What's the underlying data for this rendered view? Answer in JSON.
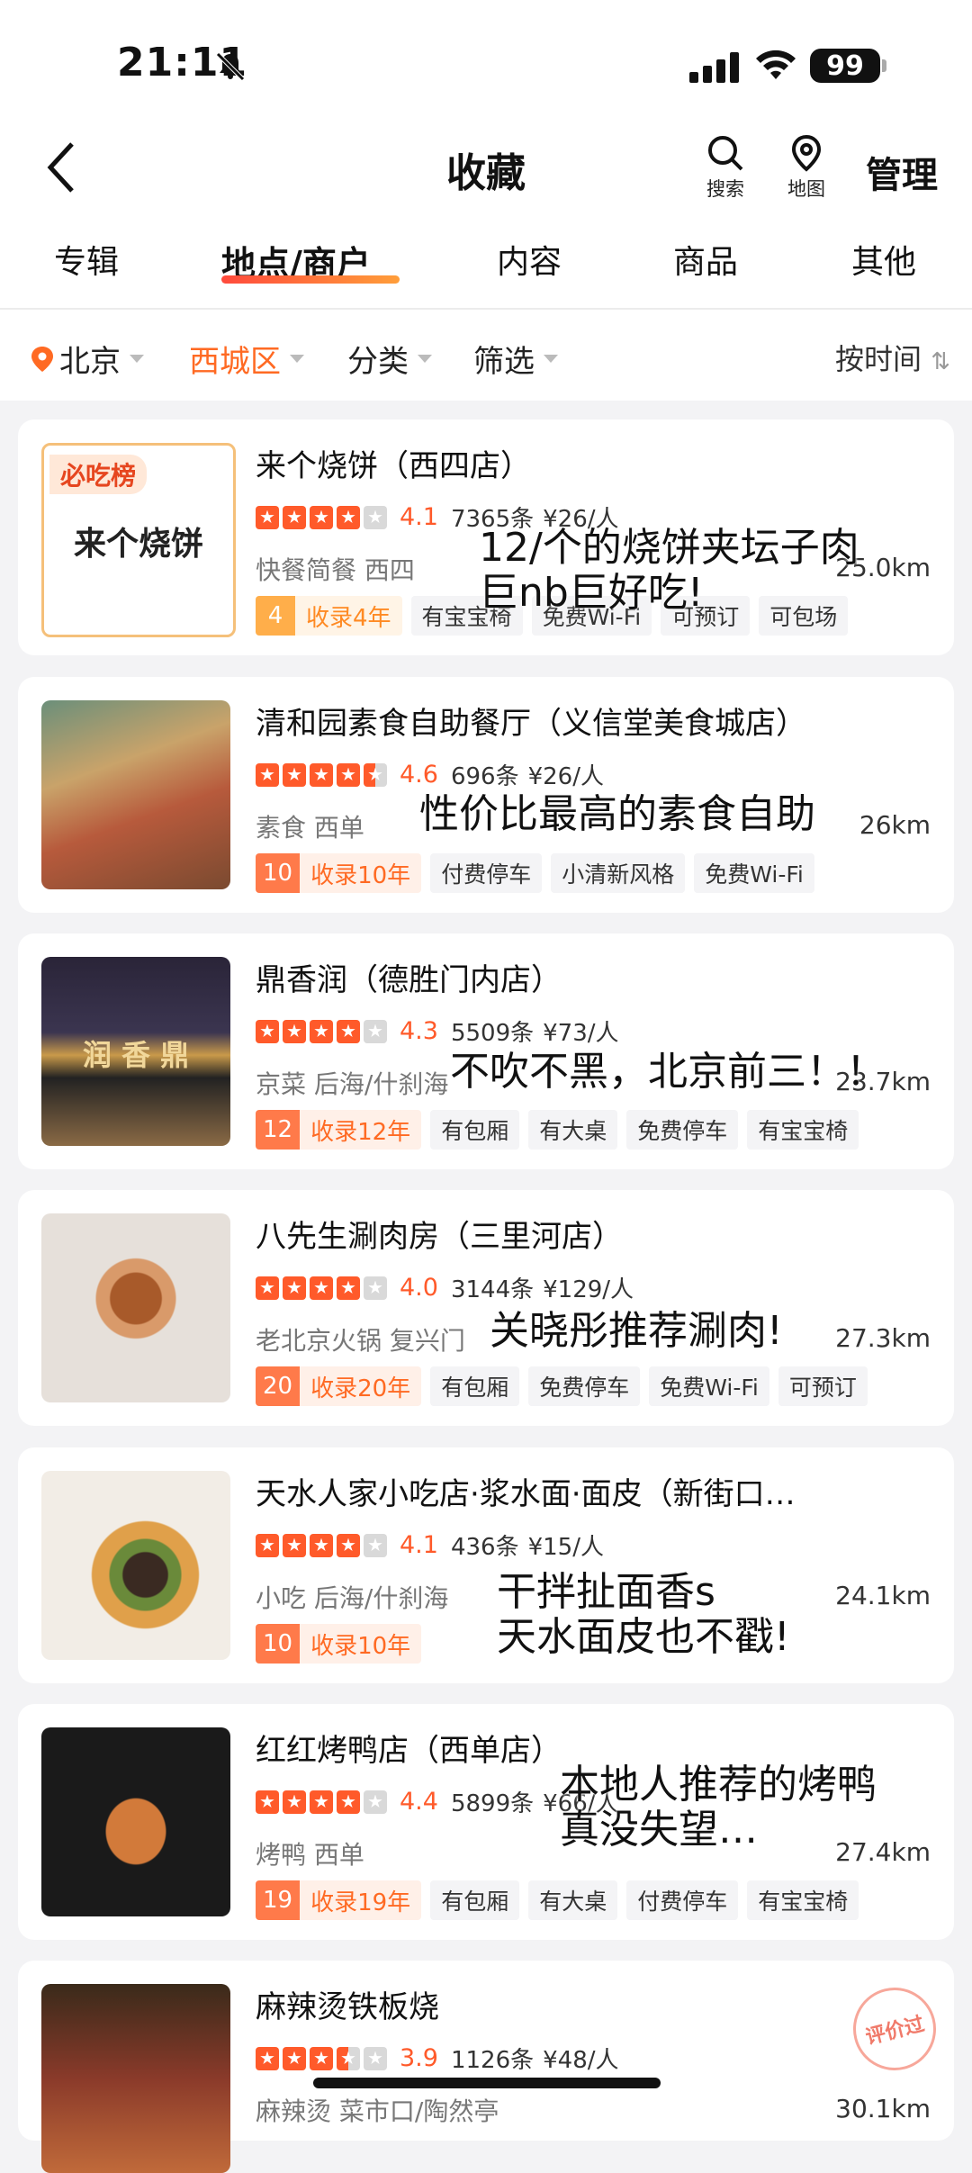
{
  "status": {
    "time": "21:11",
    "battery": "99"
  },
  "header": {
    "title": "收藏",
    "search_label": "搜索",
    "map_label": "地图",
    "manage_label": "管理"
  },
  "tabs": [
    "专辑",
    "地点/商户",
    "内容",
    "商品",
    "其他"
  ],
  "active_tab": 1,
  "filters": {
    "city": "北京",
    "district": "西城区",
    "category": "分类",
    "filter": "筛选",
    "sort": "按时间"
  },
  "items": [
    {
      "name": "来个烧饼（西四店）",
      "score": "4.1",
      "reviews": "7365条",
      "price": "¥26/人",
      "category": "快餐简餐  西四",
      "distance": "25.0km",
      "years": "4",
      "years_label": "收录4年",
      "tags": [
        "有宝宝椅",
        "免费Wi-Fi",
        "可预订",
        "可包场"
      ],
      "note": "12/个的烧饼夹坛子肉\n巨nb巨好吃!",
      "stars": [
        1,
        1,
        1,
        1,
        0
      ],
      "badge": "必吃榜",
      "thumb_text": "来个烧饼",
      "gold": true
    },
    {
      "name": "清和园素食自助餐厅（义信堂美食城店）",
      "score": "4.6",
      "reviews": "696条",
      "price": "¥26/人",
      "category": "素食  西单",
      "distance": "26km",
      "years": "10",
      "years_label": "收录10年",
      "tags": [
        "付费停车",
        "小清新风格",
        "免费Wi-Fi"
      ],
      "note": "性价比最高的素食自助",
      "stars": [
        1,
        1,
        1,
        1,
        0.5
      ]
    },
    {
      "name": "鼎香润（德胜门内店）",
      "score": "4.3",
      "reviews": "5509条",
      "price": "¥73/人",
      "category": "京菜  后海/什刹海",
      "distance": "23.7km",
      "years": "12",
      "years_label": "收录12年",
      "tags": [
        "有包厢",
        "有大桌",
        "免费停车",
        "有宝宝椅"
      ],
      "note": "不吹不黑，北京前三！！",
      "stars": [
        1,
        1,
        1,
        1,
        0
      ],
      "thumb_text": "润 香 鼎"
    },
    {
      "name": "八先生涮肉房（三里河店）",
      "score": "4.0",
      "reviews": "3144条",
      "price": "¥129/人",
      "category": "老北京火锅  复兴门",
      "distance": "27.3km",
      "years": "20",
      "years_label": "收录20年",
      "tags": [
        "有包厢",
        "免费停车",
        "免费Wi-Fi",
        "可预订"
      ],
      "note": "关晓彤推荐涮肉!",
      "stars": [
        1,
        1,
        1,
        1,
        0
      ]
    },
    {
      "name": "天水人家小吃店·浆水面·面皮（新街口…",
      "score": "4.1",
      "reviews": "436条",
      "price": "¥15/人",
      "category": "小吃  后海/什刹海",
      "distance": "24.1km",
      "years": "10",
      "years_label": "收录10年",
      "tags": [],
      "note": "干拌扯面香s\n天水面皮也不戳!",
      "stars": [
        1,
        1,
        1,
        1,
        0
      ]
    },
    {
      "name": "红红烤鸭店（西单店）",
      "score": "4.4",
      "reviews": "5899条",
      "price": "¥66/人",
      "category": "烤鸭  西单",
      "distance": "27.4km",
      "years": "19",
      "years_label": "收录19年",
      "tags": [
        "有包厢",
        "有大桌",
        "付费停车",
        "有宝宝椅"
      ],
      "note": "本地人推荐的烤鸭\n真没失望…",
      "stars": [
        1,
        1,
        1,
        1,
        0
      ]
    },
    {
      "name": "麻辣烫铁板烧",
      "score": "3.9",
      "reviews": "1126条",
      "price": "¥48/人",
      "category": "麻辣烫  菜市口/陶然亭",
      "distance": "30.1km",
      "years": "",
      "years_label": "",
      "tags": [],
      "note": "",
      "stars": [
        1,
        1,
        1,
        0.5,
        0
      ],
      "stamp": "评价过"
    }
  ],
  "colors": {
    "accent": "#ff6a23",
    "star": "#ff5a2a"
  }
}
